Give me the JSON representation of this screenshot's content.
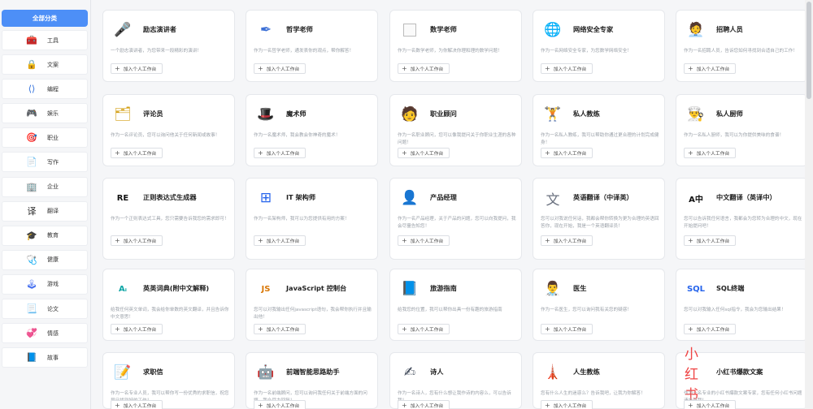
{
  "sidebar": {
    "all_label": "全部分类",
    "items": [
      {
        "label": "工具",
        "icon": "toolbox-icon",
        "glyph": "🧰",
        "color": "#f4b400"
      },
      {
        "label": "文案",
        "icon": "lock-icon",
        "glyph": "🔒",
        "color": "#3b82f6"
      },
      {
        "label": "编程",
        "icon": "code-icon",
        "glyph": "⟨⟩",
        "color": "#2b6cdb"
      },
      {
        "label": "娱乐",
        "icon": "game-icon",
        "glyph": "🎮",
        "color": "#7c3aed"
      },
      {
        "label": "职业",
        "icon": "profession-icon",
        "glyph": "🎯",
        "color": "#f97316"
      },
      {
        "label": "写作",
        "icon": "document-icon",
        "glyph": "📄",
        "color": "#6b7cf0"
      },
      {
        "label": "企业",
        "icon": "building-icon",
        "glyph": "🏢",
        "color": "#f97316"
      },
      {
        "label": "翻译",
        "icon": "translate-icon",
        "glyph": "译",
        "color": "#222222"
      },
      {
        "label": "教育",
        "icon": "graduation-cap-icon",
        "glyph": "🎓",
        "color": "#1f6feb"
      },
      {
        "label": "健康",
        "icon": "medical-kit-icon",
        "glyph": "🩺",
        "color": "#e23c3c"
      },
      {
        "label": "游戏",
        "icon": "joystick-icon",
        "glyph": "🕹",
        "color": "#4c74f0"
      },
      {
        "label": "论文",
        "icon": "paper-icon",
        "glyph": "📃",
        "color": "#3b82f6"
      },
      {
        "label": "情感",
        "icon": "heart-icon",
        "glyph": "💞",
        "color": "#e23c3c"
      },
      {
        "label": "故事",
        "icon": "book-icon",
        "glyph": "📘",
        "color": "#1e3a8a"
      }
    ]
  },
  "add_label": "加入个人工作台",
  "rows": [
    [
      {
        "title": "励志演讲者",
        "icon": "speech-icon",
        "glyph": "🎤",
        "color": "#e8693a",
        "desc": "一个励志演讲者，为您带来一段精彩的演讲！"
      },
      {
        "title": "哲学老师",
        "icon": "feather-pen-icon",
        "glyph": "✒",
        "color": "#3b6fd6",
        "desc": "作为一名哲学老师，通发表你的观点，帮你解答！"
      },
      {
        "title": "数学老师",
        "icon": "broken-image-icon",
        "glyph": "",
        "color": "#999999",
        "desc": "作为一名数学老师，为你解决你理和理的数学问题！"
      },
      {
        "title": "网络安全专家",
        "icon": "globe-shield-icon",
        "glyph": "🌐",
        "color": "#2aa876",
        "desc": "作为一名网络安全专家，为您数学网络安全！"
      },
      {
        "title": "招聘人员",
        "icon": "recruiter-icon",
        "glyph": "🧑‍💼",
        "color": "#1f2937",
        "desc": "作为一名招聘人员，告诉您如何寻找到合适自己的工作！"
      }
    ],
    [
      {
        "title": "评论员",
        "icon": "commentator-icon",
        "glyph": "🗂",
        "color": "#d4a017",
        "desc": "作为一名评论员，您可以询问他关于任何新闻或故事！"
      },
      {
        "title": "魔术师",
        "icon": "magic-hat-icon",
        "glyph": "🎩",
        "color": "#2aa876",
        "desc": "作为一名魔术师，我会教会你神奇的魔术！"
      },
      {
        "title": "职业顾问",
        "icon": "career-advisor-icon",
        "glyph": "🧑",
        "color": "#0f766e",
        "desc": "作为一名职业顾问，您可以像我提问关于你职业生涯的各种问题！"
      },
      {
        "title": "私人教练",
        "icon": "trainer-icon",
        "glyph": "🏋",
        "color": "#2563eb",
        "desc": "作为一名私人教练，我可以帮助你通过更合理的计划完成健身！"
      },
      {
        "title": "私人厨师",
        "icon": "chef-icon",
        "glyph": "👨‍🍳",
        "color": "#7c3aed",
        "desc": "作为一名私人厨师，我可以为你提供美味的食谱！"
      }
    ],
    [
      {
        "title": "正则表达式生成器",
        "icon": "regex-icon",
        "glyph": "RE",
        "color": "#111111",
        "desc": "作为一个正则表达式工具，您只需要告诉我您的需求即可！"
      },
      {
        "title": "IT 架构师",
        "icon": "architecture-icon",
        "glyph": "⊞",
        "color": "#2563eb",
        "desc": "作为一名架构师，我可以为您提供有用的方案！"
      },
      {
        "title": "产品经理",
        "icon": "product-manager-icon",
        "glyph": "👤",
        "color": "#16a34a",
        "desc": "作为一名产品经理，关于产品的问题，您可以向我提问，我会尽量告知您！"
      },
      {
        "title": "英语翻译（中译英）",
        "icon": "translate-en-icon",
        "glyph": "文",
        "color": "#6b7280",
        "desc": "您可以对我说任何话，我都会帮你转换为更为合理的英语回答你，现在开始，我是一个英语翻译员！"
      },
      {
        "title": "中文翻译（英译中）",
        "icon": "translate-zh-icon",
        "glyph": "A中",
        "color": "#111111",
        "desc": "您可以告诉我任何语言，我都会为您转为合理的中文，现在开始提问吧！"
      }
    ],
    [
      {
        "title": "英英词典(附中文解释)",
        "icon": "dictionary-icon",
        "glyph": "Aᵢ",
        "color": "#0ea5a5",
        "desc": "给我任何英文单词，我会给你单数的英文翻译，并且告诉你中文意思！"
      },
      {
        "title": "JavaScript 控制台",
        "icon": "javascript-icon",
        "glyph": "JS",
        "color": "#d97706",
        "desc": "您可以对我输出任何javascript语句，我会帮你执行并且输出他！"
      },
      {
        "title": "旅游指南",
        "icon": "travel-guide-icon",
        "glyph": "📘",
        "color": "#2563eb",
        "desc": "给我您的位置，我可以帮你出具一份有趣的旅游指南"
      },
      {
        "title": "医生",
        "icon": "doctor-icon",
        "glyph": "👨‍⚕️",
        "color": "#0ea5e9",
        "desc": "作为一名医生，您可以询问我有关您的疑惑！"
      },
      {
        "title": "SQL终端",
        "icon": "sql-icon",
        "glyph": "SQL",
        "color": "#2563eb",
        "desc": "您可以对我输入任何sql指令，我会为您输出结果！"
      }
    ],
    [
      {
        "title": "求职信",
        "icon": "cover-letter-icon",
        "glyph": "📝",
        "color": "#65a30d",
        "desc": "作为一名专业人员，我可以帮你写一份优秀的求职信，祝您早日找到好的工作！"
      },
      {
        "title": "前端智能思路助手",
        "icon": "robot-icon",
        "glyph": "🤖",
        "color": "#2563eb",
        "desc": "作为一名前端顾问，您可以询问我任何关于前端方面的问题，我会尽力回复！"
      },
      {
        "title": "诗人",
        "icon": "poet-icon",
        "glyph": "✍",
        "color": "#374151",
        "desc": "作为一名诗人，您有什么想让我作诗的内容么，可以告诉我！"
      },
      {
        "title": "人生教练",
        "icon": "life-coach-icon",
        "glyph": "🗼",
        "color": "#dc2626",
        "desc": "您有什么人生的迷惑么？告诉我吧，让我为你解答！"
      },
      {
        "title": "小红书爆款文案",
        "icon": "xiaohongshu-icon",
        "glyph": "小红书",
        "color": "#ef4444",
        "desc": "作为一名专业的小红书爆款文案专家，您有任何小红书问题请告诉我！"
      }
    ]
  ]
}
